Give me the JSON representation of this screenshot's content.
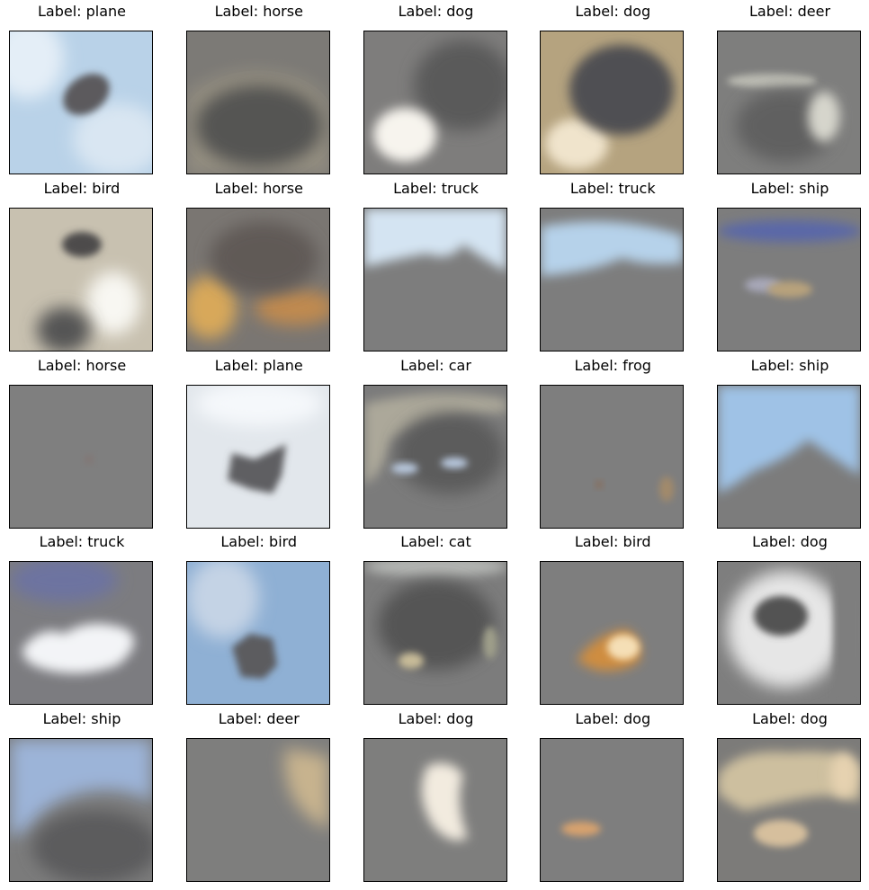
{
  "figure": {
    "label_prefix": "Label: ",
    "rows": 5,
    "cols": 5,
    "cells": [
      {
        "label": "plane",
        "image": "blurry-light-blue-sky-with-dark-oval",
        "colors": {
          "base": "#b9d2e8",
          "accent": "#5c5a5d"
        }
      },
      {
        "label": "horse",
        "image": "gray-with-faint-beige-outline",
        "colors": {
          "base": "#7c7a76",
          "accent": "#a9a08a"
        }
      },
      {
        "label": "dog",
        "image": "gray-with-white-blob-bottom-left",
        "colors": {
          "base": "#7e7d7c",
          "accent": "#f7f4ee"
        }
      },
      {
        "label": "dog",
        "image": "beige-ring-around-dark-center",
        "colors": {
          "base": "#b5a37f",
          "accent": "#f0e4cc"
        }
      },
      {
        "label": "deer",
        "image": "gray-with-pale-streak-and-blob",
        "colors": {
          "base": "#7e7e7d",
          "accent": "#d6d5cc"
        }
      },
      {
        "label": "bird",
        "image": "beige-white-with-dark-spot",
        "colors": {
          "base": "#c8c1b0",
          "accent": "#f8f7f2"
        }
      },
      {
        "label": "horse",
        "image": "gray-with-orange-gold-blur-bottom",
        "colors": {
          "base": "#7a7672",
          "accent": "#d8a85a"
        }
      },
      {
        "label": "truck",
        "image": "light-blue-sky-over-gray",
        "colors": {
          "base": "#7d7d7d",
          "accent": "#d4e4f2"
        }
      },
      {
        "label": "truck",
        "image": "light-blue-band-over-gray",
        "colors": {
          "base": "#7d7d7d",
          "accent": "#b6d2ea"
        }
      },
      {
        "label": "ship",
        "image": "blue-streak-and-beige-blob-on-gray",
        "colors": {
          "base": "#7d7d7d",
          "accent": "#5a68a8"
        }
      },
      {
        "label": "horse",
        "image": "plain-gray",
        "colors": {
          "base": "#7f7f7f",
          "accent": "#86706c"
        }
      },
      {
        "label": "plane",
        "image": "white-with-dark-star-shape",
        "colors": {
          "base": "#e2e7ec",
          "accent": "#5e5e62"
        }
      },
      {
        "label": "car",
        "image": "gray-with-beige-arc-and-blue-spots",
        "colors": {
          "base": "#7b7b7b",
          "accent": "#b9c9df"
        }
      },
      {
        "label": "frog",
        "image": "gray-with-faint-orange-spots",
        "colors": {
          "base": "#7e7e7e",
          "accent": "#a38a6a"
        }
      },
      {
        "label": "ship",
        "image": "blue-sky-over-dark-triangle",
        "colors": {
          "base": "#7c7c7c",
          "accent": "#9fc2e6"
        }
      },
      {
        "label": "truck",
        "image": "white-blob-with-blue-tint",
        "colors": {
          "base": "#7c7c80",
          "accent": "#f3f4f7"
        }
      },
      {
        "label": "bird",
        "image": "blue-frame-with-dark-center",
        "colors": {
          "base": "#8fb0d4",
          "accent": "#5b5b5f"
        }
      },
      {
        "label": "cat",
        "image": "gray-with-beige-spots",
        "colors": {
          "base": "#7c7c7c",
          "accent": "#c7bb98"
        }
      },
      {
        "label": "bird",
        "image": "gray-with-orange-white-blob",
        "colors": {
          "base": "#7e7e7e",
          "accent": "#f5dfb6"
        }
      },
      {
        "label": "dog",
        "image": "white-ring-with-dark-center",
        "colors": {
          "base": "#7e7e7e",
          "accent": "#e6e6e6"
        }
      },
      {
        "label": "ship",
        "image": "blue-wave-over-dark-gray",
        "colors": {
          "base": "#7b7b7b",
          "accent": "#9cb4d8"
        }
      },
      {
        "label": "deer",
        "image": "gray-with-beige-patch-right",
        "colors": {
          "base": "#7e7e7d",
          "accent": "#c7b38e"
        }
      },
      {
        "label": "dog",
        "image": "gray-with-white-blob-center",
        "colors": {
          "base": "#7e7e7d",
          "accent": "#f2ebdf"
        }
      },
      {
        "label": "dog",
        "image": "gray-with-small-orange-blob",
        "colors": {
          "base": "#7e7e7e",
          "accent": "#d7a26e"
        }
      },
      {
        "label": "dog",
        "image": "beige-arc-with-orange-blob",
        "colors": {
          "base": "#7c7b79",
          "accent": "#e6d2b0"
        }
      }
    ]
  }
}
